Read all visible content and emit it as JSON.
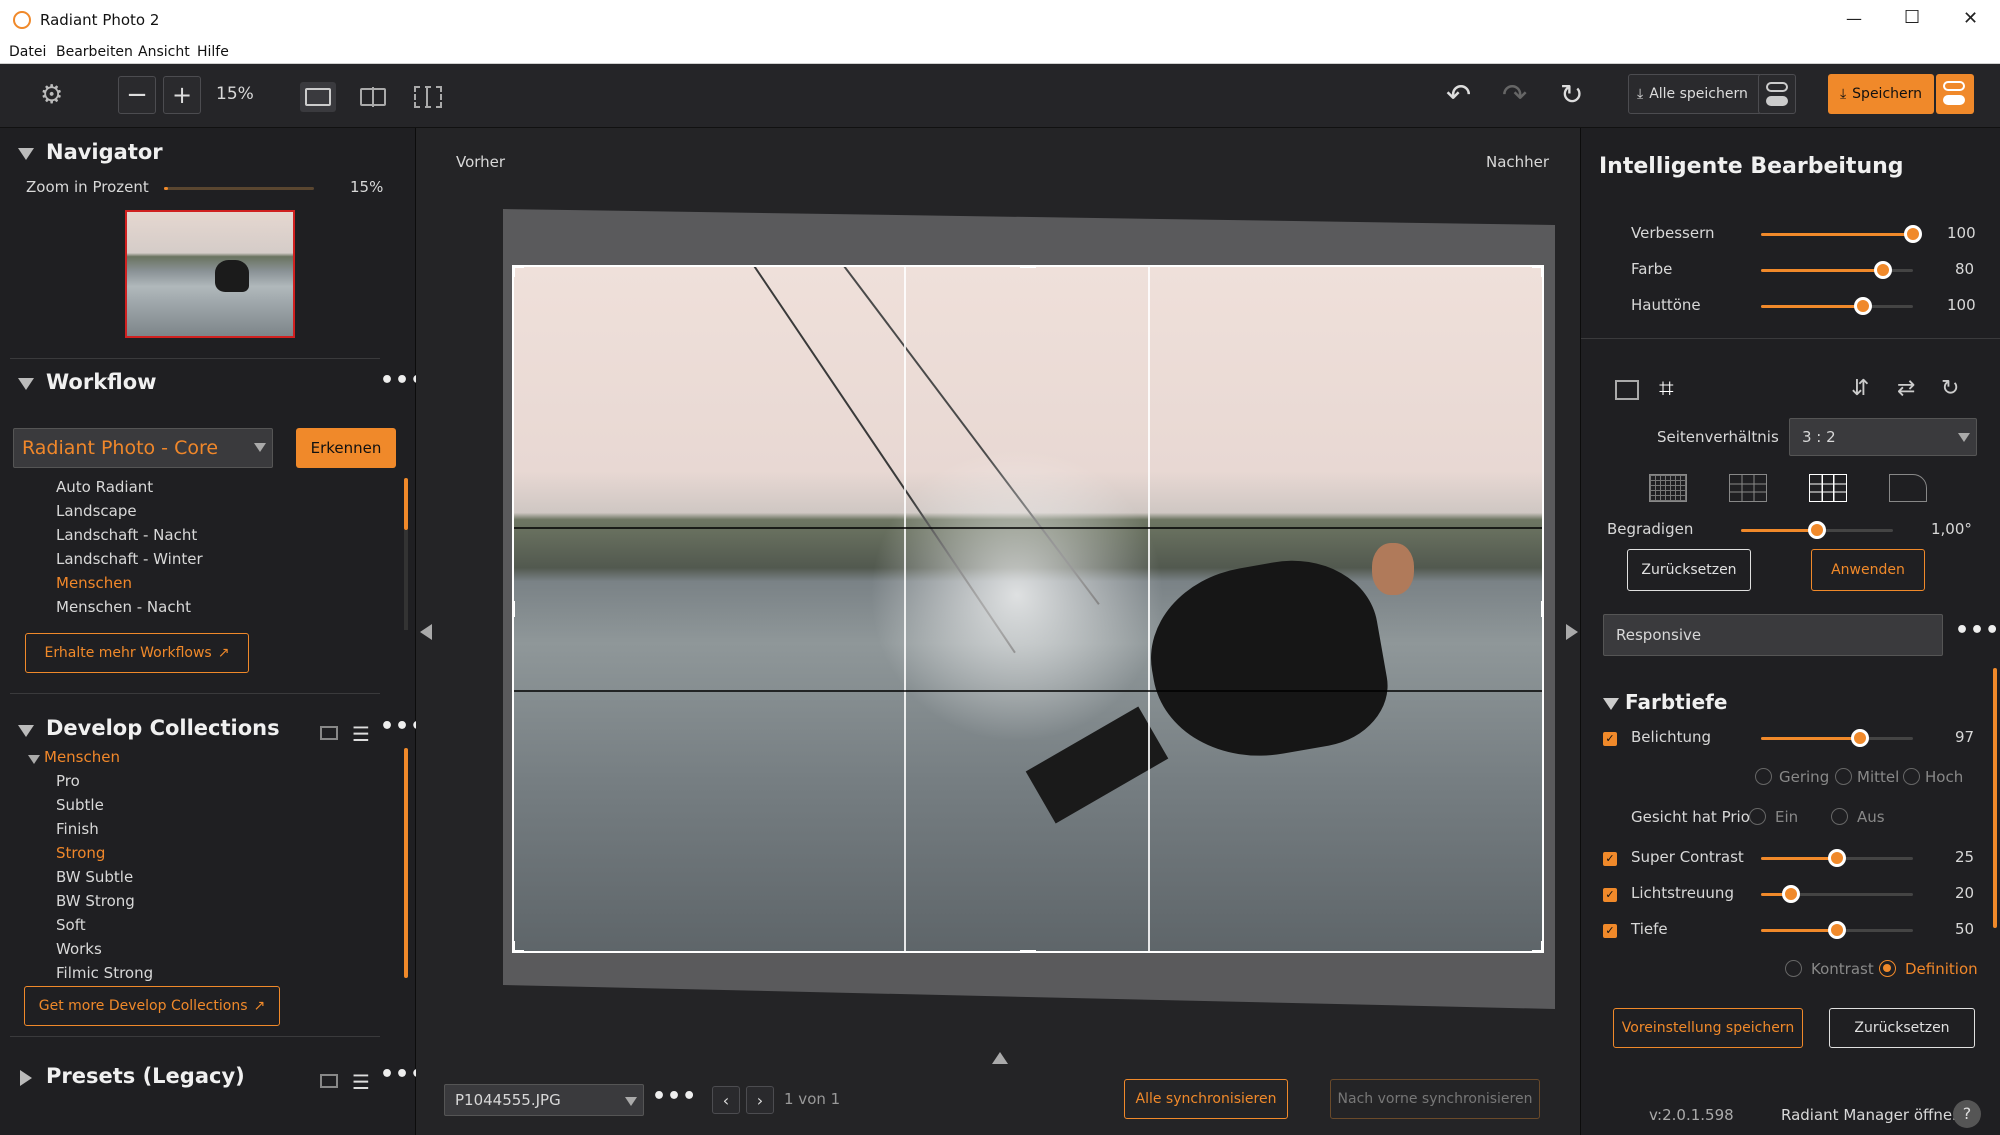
{
  "window": {
    "title": "Radiant Photo 2",
    "minimize": "—",
    "maximize": "☐",
    "close": "✕"
  },
  "menu": [
    "Datei",
    "Bearbeiten",
    "Ansicht",
    "Hilfe"
  ],
  "toolbar": {
    "zoom_value": "15%",
    "save_all_label": "Alle speichern",
    "save_label": "Speichern"
  },
  "navigator": {
    "title": "Navigator",
    "zoom_label": "Zoom in Prozent",
    "zoom_value": "15%",
    "zoom_fraction": 0.15
  },
  "workflow": {
    "title": "Workflow",
    "selected": "Radiant Photo - Core",
    "detect_label": "Erkennen",
    "items": [
      "Auto Radiant",
      "Landscape",
      "Landschaft - Nacht",
      "Landschaft - Winter",
      "Menschen",
      "Menschen - Nacht"
    ],
    "active_item": "Menschen",
    "more_label": "Erhalte mehr Workflows"
  },
  "develop_collections": {
    "title": "Develop Collections",
    "group": "Menschen",
    "items": [
      "Pro",
      "Subtle",
      "Finish",
      "Strong",
      "BW Subtle",
      "BW Strong",
      "Soft",
      "Works",
      "Filmic Strong"
    ],
    "active_item": "Strong",
    "more_label": "Get more Develop Collections"
  },
  "presets": {
    "title": "Presets (Legacy)"
  },
  "canvas": {
    "before_label": "Vorher",
    "after_label": "Nachher",
    "filename": "P1044555.JPG",
    "page_info": "1 von 1",
    "sync_all_label": "Alle synchronisieren",
    "sync_forward_label": "Nach vorne synchronisieren"
  },
  "smart_edit": {
    "title": "Intelligente Bearbeitung",
    "sliders": [
      {
        "label": "Verbessern",
        "value": "100",
        "fraction": 1.0
      },
      {
        "label": "Farbe",
        "value": "80",
        "fraction": 0.8
      },
      {
        "label": "Hauttöne",
        "value": "100",
        "fraction": 0.67
      }
    ]
  },
  "crop": {
    "aspect_label": "Seitenverhältnis",
    "aspect_value": "3 : 2",
    "straighten_label": "Begradigen",
    "straighten_value": "1,00°",
    "straighten_fraction": 0.5,
    "reset_label": "Zurücksetzen",
    "apply_label": "Anwenden"
  },
  "profile": {
    "value": "Responsive"
  },
  "color_depth": {
    "title": "Farbtiefe",
    "exposure": {
      "label": "Belichtung",
      "value": "97",
      "fraction": 0.65
    },
    "levels": [
      "Gering",
      "Mittel",
      "Hoch"
    ],
    "face_priority_label": "Gesicht hat Prio",
    "face_options": [
      "Ein",
      "Aus"
    ],
    "super_contrast": {
      "label": "Super Contrast",
      "value": "25",
      "fraction": 0.5
    },
    "light_scatter": {
      "label": "Lichtstreuung",
      "value": "20",
      "fraction": 0.2
    },
    "depth": {
      "label": "Tiefe",
      "value": "50",
      "fraction": 0.5
    },
    "depth_modes": [
      "Kontrast",
      "Definition"
    ],
    "active_depth_mode": "Definition"
  },
  "footer": {
    "save_preset_label": "Voreinstellung speichern",
    "reset_label": "Zurücksetzen",
    "version": "v:2.0.1.598",
    "manager_label": "Radiant Manager öffnen",
    "help": "?"
  },
  "colors": {
    "accent": "#f0892a",
    "panel": "#1f1f22",
    "toolbar": "#252528"
  }
}
